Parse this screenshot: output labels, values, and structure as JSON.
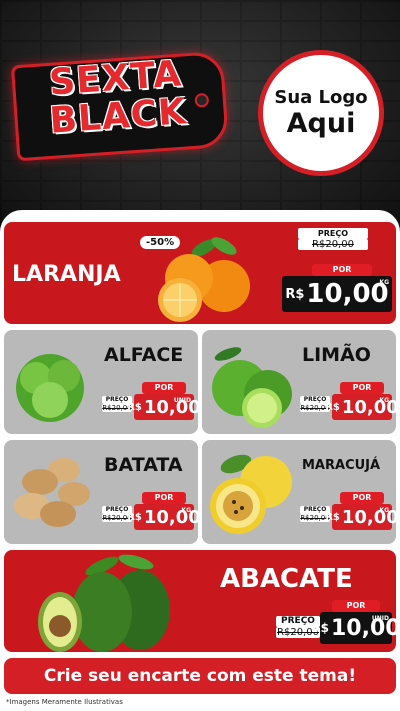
{
  "header": {
    "promo_line1": "SEXTA",
    "promo_line2": "BLACK",
    "logo_line1": "Sua Logo",
    "logo_line2": "Aqui"
  },
  "products": {
    "laranja": {
      "name": "LARANJA",
      "discount": "-50%",
      "preco_label": "PREÇO",
      "old_price": "R$20,00",
      "por_label": "POR",
      "currency": "R$",
      "price": "10,00",
      "unit": "KG"
    },
    "alface": {
      "name": "ALFACE",
      "preco_label": "PREÇO",
      "old_price": "R$20,00",
      "por_label": "POR",
      "currency": "R$",
      "price": "10,00",
      "unit": "UNID"
    },
    "limao": {
      "name": "LIMÃO",
      "preco_label": "PREÇO",
      "old_price": "R$20,00",
      "por_label": "POR",
      "currency": "R$",
      "price": "10,00",
      "unit": "KG"
    },
    "batata": {
      "name": "BATATA",
      "preco_label": "PREÇO",
      "old_price": "R$20,00",
      "por_label": "POR",
      "currency": "R$",
      "price": "10,00",
      "unit": "KG"
    },
    "maracuja": {
      "name": "MARACUJÁ",
      "preco_label": "PREÇO",
      "old_price": "R$20,00",
      "por_label": "POR",
      "currency": "R$",
      "price": "10,00",
      "unit": "KG"
    },
    "abacate": {
      "name": "ABACATE",
      "preco_label": "PREÇO",
      "old_price": "R$20,00",
      "por_label": "POR",
      "currency": "R$",
      "price": "10,00",
      "unit": "UNID"
    }
  },
  "cta": {
    "label": "Crie seu encarte com este tema!"
  },
  "footnote": "*Imagens Meramente Ilustrativas",
  "colors": {
    "accent": "#d41f26",
    "card_gray": "#b9b9b9",
    "dark": "#111111"
  }
}
